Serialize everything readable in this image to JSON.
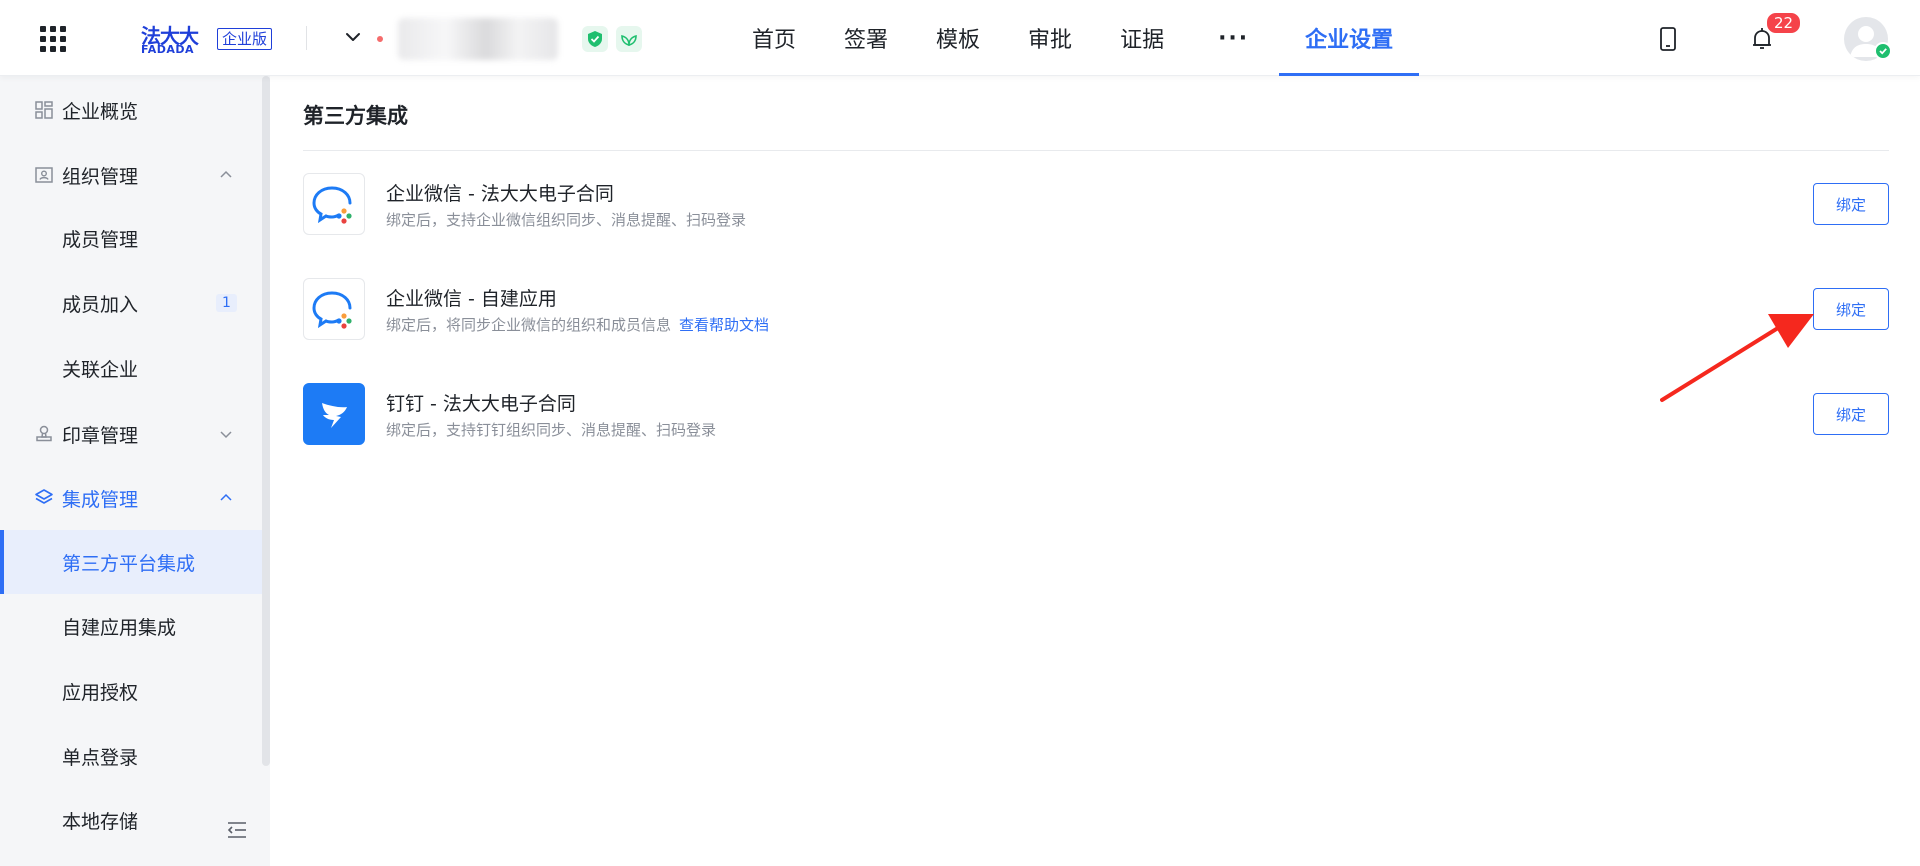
{
  "header": {
    "logo_cn": "法大大",
    "logo_en": "FADADA",
    "edition_badge": "企业版",
    "org_name_visible": "-",
    "notification_count": "22",
    "nav": [
      {
        "label": "首页"
      },
      {
        "label": "签署"
      },
      {
        "label": "模板"
      },
      {
        "label": "审批"
      },
      {
        "label": "证据"
      },
      {
        "label": "···"
      },
      {
        "label": "企业设置",
        "active": true
      }
    ]
  },
  "sidebar": {
    "items": [
      {
        "label": "企业概览",
        "icon": "dashboard-icon"
      },
      {
        "label": "组织管理",
        "icon": "org-icon",
        "expanded": true
      },
      {
        "label": "成员管理"
      },
      {
        "label": "成员加入",
        "count": "1"
      },
      {
        "label": "关联企业"
      },
      {
        "label": "印章管理",
        "icon": "seal-icon",
        "expanded": false
      },
      {
        "label": "集成管理",
        "icon": "layers-icon",
        "expanded": true
      },
      {
        "label": "第三方平台集成",
        "active": true
      },
      {
        "label": "自建应用集成"
      },
      {
        "label": "应用授权"
      },
      {
        "label": "单点登录"
      },
      {
        "label": "本地存储"
      }
    ]
  },
  "main": {
    "title": "第三方集成",
    "integrations": [
      {
        "name": "企业微信 - 法大大电子合同",
        "desc": "绑定后，支持企业微信组织同步、消息提醒、扫码登录",
        "link": "",
        "button": "绑定",
        "icon": "wecom-icon"
      },
      {
        "name": "企业微信 - 自建应用",
        "desc": "绑定后，将同步企业微信的组织和成员信息",
        "link": "查看帮助文档",
        "button": "绑定",
        "icon": "wecom-icon"
      },
      {
        "name": "钉钉 - 法大大电子合同",
        "desc": "绑定后，支持钉钉组织同步、消息提醒、扫码登录",
        "link": "",
        "button": "绑定",
        "icon": "dingtalk-icon"
      }
    ]
  },
  "colors": {
    "accent": "#2e6ef5",
    "brand": "#1f3fd9",
    "annotation_arrow": "#f5281e",
    "badge": "#f5434a"
  }
}
